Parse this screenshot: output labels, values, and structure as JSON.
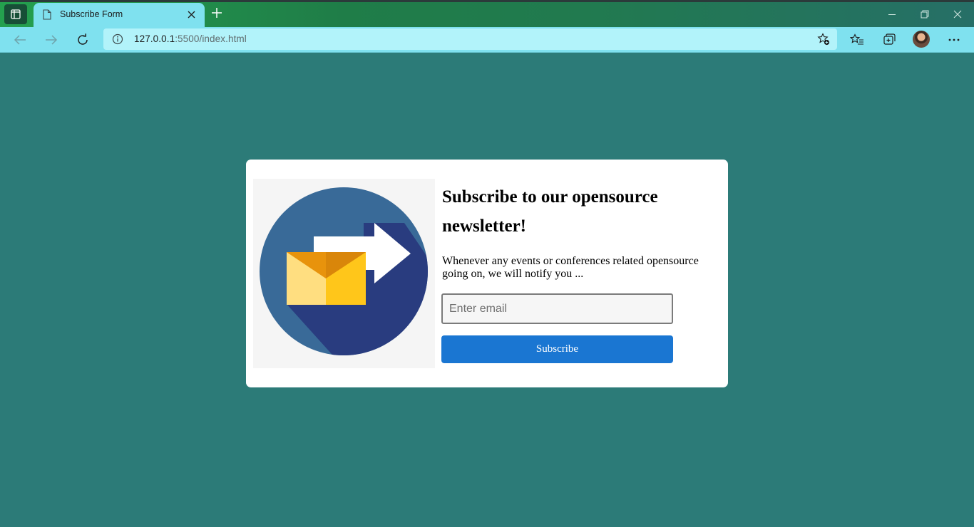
{
  "browser": {
    "tab_title": "Subscribe Form",
    "url_host": "127.0.0.1",
    "url_rest": ":5500/index.html"
  },
  "icons": {
    "tab_actions": "tab-actions-icon",
    "doc": "document-icon",
    "close": "close-icon",
    "new_tab": "plus-icon",
    "minimize": "minimize-icon",
    "restore": "restore-icon",
    "window_close": "window-close-icon",
    "back": "back-arrow-icon",
    "forward": "forward-arrow-icon",
    "refresh": "refresh-icon",
    "info": "info-icon",
    "add_favorite": "star-add-icon",
    "favorites": "favorites-icon",
    "collections": "collections-icon",
    "more": "more-icon"
  },
  "colors": {
    "page_background": "#2c7b78",
    "button": "#1a76d2",
    "card": "#ffffff"
  },
  "form": {
    "heading": "Subscribe to our opensource newsletter!",
    "description": "Whenever any events or conferences related opensource going on, we will notify you ...",
    "email_placeholder": "Enter email",
    "email_value": "",
    "button_label": "Subscribe"
  }
}
